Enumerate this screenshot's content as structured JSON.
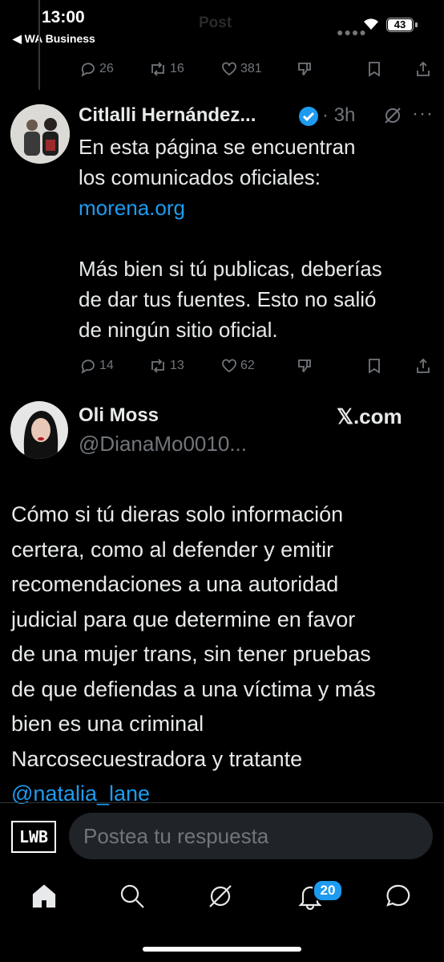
{
  "status_bar": {
    "time": "13:00",
    "back_app": "◀ WA Business",
    "ghost_title": "Post",
    "battery": "43"
  },
  "prev_post_actions": {
    "replies": "26",
    "reposts": "16",
    "likes": "381"
  },
  "post1": {
    "author": "Citlalli Hernández...",
    "time": "3h",
    "text_line1": "En esta página se encuentran",
    "text_line2": "los comunicados oficiales:",
    "link": "morena.org",
    "text_line4": "Más bien si tú publicas, deberías",
    "text_line5": "de dar tus fuentes. Esto no salió",
    "text_line6": "de ningún sitio oficial.",
    "replies": "14",
    "reposts": "13",
    "likes": "62"
  },
  "post2": {
    "author": "Oli Moss",
    "handle": "@DianaMo0010...",
    "source": "𝕏.com",
    "lines": [
      "Cómo si tú dieras solo información",
      "certera, como al defender y emitir",
      "recomendaciones a una autoridad",
      "judicial para que determine en favor",
      "de una mujer trans, sin tener pruebas",
      "de que defiendas a una víctima y más",
      "bien es una criminal",
      "Narcosecuestradora y tratante"
    ],
    "mention": "@natalia_lane"
  },
  "reply_bar": {
    "logo_text": "LWB",
    "placeholder": "Postea tu respuesta"
  },
  "nav": {
    "notifications_badge": "20"
  },
  "colors": {
    "accent": "#1d9bf0",
    "muted": "#71767b",
    "text": "#e7e9ea"
  }
}
